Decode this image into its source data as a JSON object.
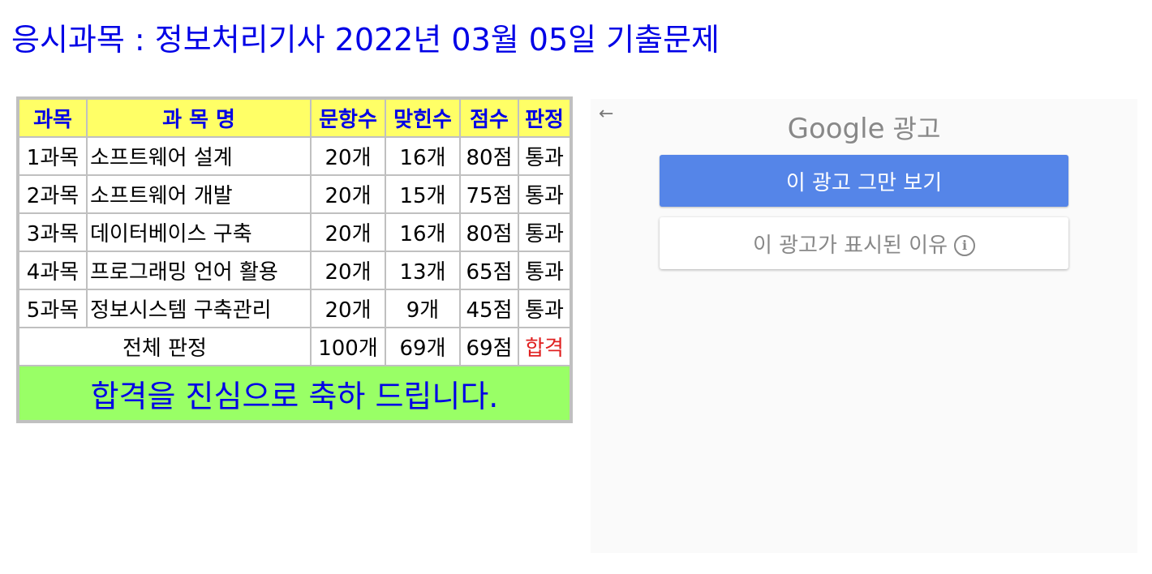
{
  "page": {
    "title": "응시과목 : 정보처리기사 2022년 03월 05일 기출문제"
  },
  "table": {
    "headers": [
      "과목",
      "과 목 명",
      "문항수",
      "맞힌수",
      "점수",
      "판정"
    ],
    "rows": [
      {
        "subject": "1과목",
        "name": "소프트웨어 설계",
        "questions": "20개",
        "correct": "16개",
        "score": "80점",
        "result": "통과"
      },
      {
        "subject": "2과목",
        "name": "소프트웨어 개발",
        "questions": "20개",
        "correct": "15개",
        "score": "75점",
        "result": "통과"
      },
      {
        "subject": "3과목",
        "name": "데이터베이스 구축",
        "questions": "20개",
        "correct": "16개",
        "score": "80점",
        "result": "통과"
      },
      {
        "subject": "4과목",
        "name": "프로그래밍 언어 활용",
        "questions": "20개",
        "correct": "13개",
        "score": "65점",
        "result": "통과"
      },
      {
        "subject": "5과목",
        "name": "정보시스템 구축관리",
        "questions": "20개",
        "correct": "9개",
        "score": "45점",
        "result": "통과"
      }
    ],
    "total": {
      "label": "전체 판정",
      "questions": "100개",
      "correct": "69개",
      "score": "69점",
      "result": "합격"
    },
    "congrats": "합격을 진심으로 축하 드립니다."
  },
  "ad": {
    "back_icon": "←",
    "brand": "Google",
    "label": "광고",
    "stop_button": "이 광고 그만 보기",
    "why_button": "이 광고가 표시된 이유",
    "info_icon": "i"
  },
  "colors": {
    "title": "#0000e6",
    "header_bg": "#ffff66",
    "congrats_bg": "#99ff66",
    "pass_result": "#e02020",
    "ad_button": "#5585e8"
  }
}
